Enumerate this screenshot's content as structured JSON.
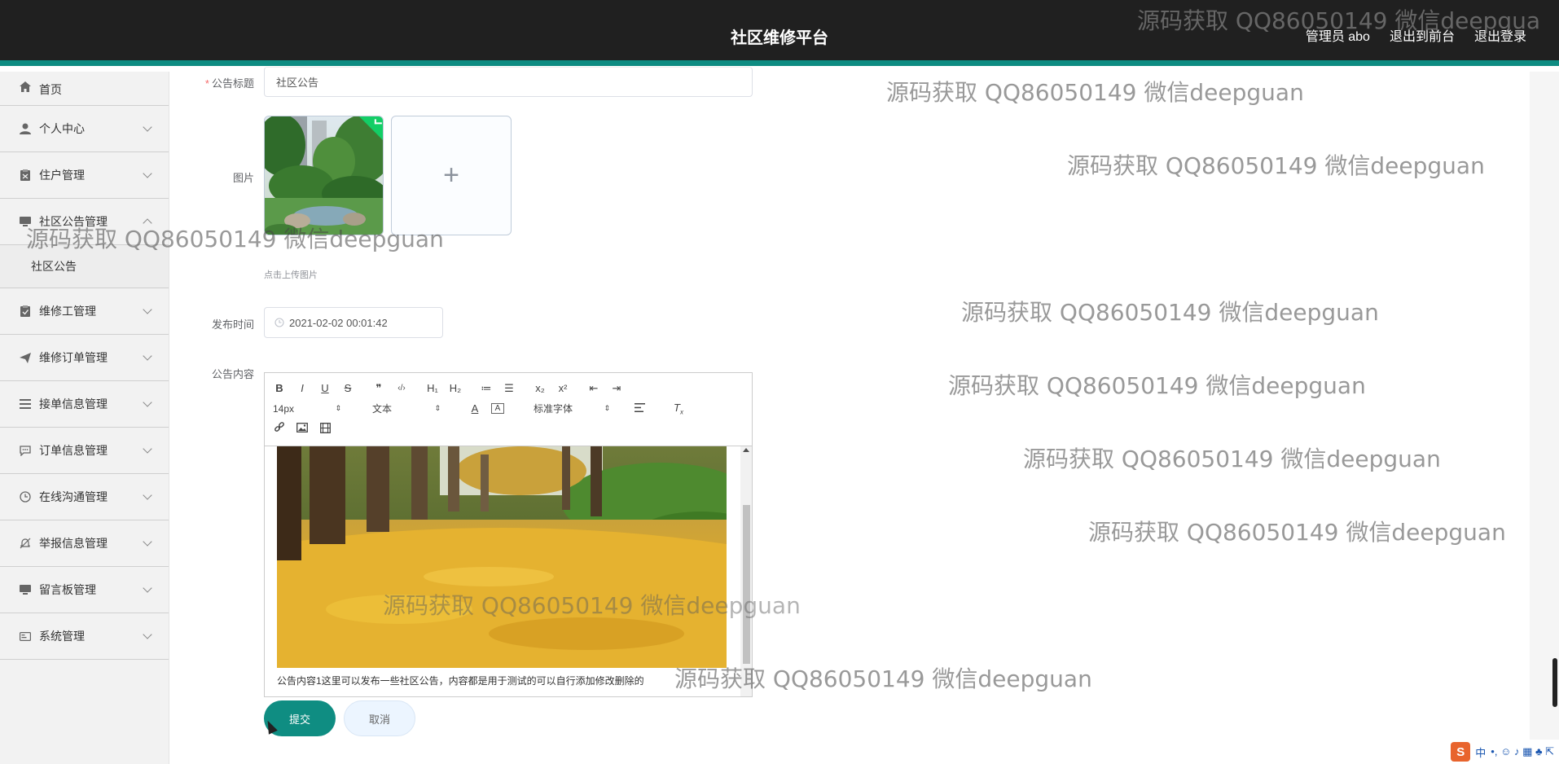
{
  "header": {
    "title": "社区维修平台",
    "links": [
      "管理员 abo",
      "退出到前台",
      "退出登录"
    ]
  },
  "sidebar": {
    "items": [
      {
        "label": "首页",
        "icon": "home-icon"
      },
      {
        "label": "个人中心",
        "icon": "user-icon"
      },
      {
        "label": "住户管理",
        "icon": "clipboard-icon"
      },
      {
        "label": "社区公告管理",
        "icon": "monitor-icon"
      },
      {
        "label": "维修工管理",
        "icon": "clipboard-check-icon"
      },
      {
        "label": "维修订单管理",
        "icon": "send-icon"
      },
      {
        "label": "接单信息管理",
        "icon": "menu-icon"
      },
      {
        "label": "订单信息管理",
        "icon": "chat-icon"
      },
      {
        "label": "在线沟通管理",
        "icon": "clock-icon"
      },
      {
        "label": "举报信息管理",
        "icon": "bell-off-icon"
      },
      {
        "label": "留言板管理",
        "icon": "monitor-icon"
      },
      {
        "label": "系统管理",
        "icon": "card-icon"
      }
    ],
    "sub_item": "社区公告"
  },
  "form": {
    "title_label": "公告标题",
    "title_value": "社区公告",
    "image_label": "图片",
    "upload_hint": "点击上传图片",
    "plus": "+",
    "time_label": "发布时间",
    "time_value": "2021-02-02 00:01:42",
    "content_label": "公告内容",
    "content_text": "公告内容1这里可以发布一些社区公告，内容都是用于测试的可以自行添加修改删除的",
    "submit": "提交",
    "cancel": "取消"
  },
  "editor": {
    "row1": [
      "B",
      "I",
      "U",
      "S",
      "❞",
      "‹/›",
      "H₁",
      "H₂",
      "≔",
      "☰",
      "x₂",
      "x²",
      "⇤",
      "⇥"
    ],
    "font_size": "14px",
    "block_type": "文本",
    "font_family": "标准字体",
    "row3_icons": [
      "link-icon",
      "image-icon",
      "video-icon"
    ]
  },
  "watermark": "源码获取 QQ86050149 微信deepguan",
  "watermark_cut": "源码获取 QQ86050149 微信deepgua",
  "ime": {
    "s": "S",
    "lang": "中",
    "symbols": "•, ☺ ♪ ▦ ♣ ⇱"
  }
}
